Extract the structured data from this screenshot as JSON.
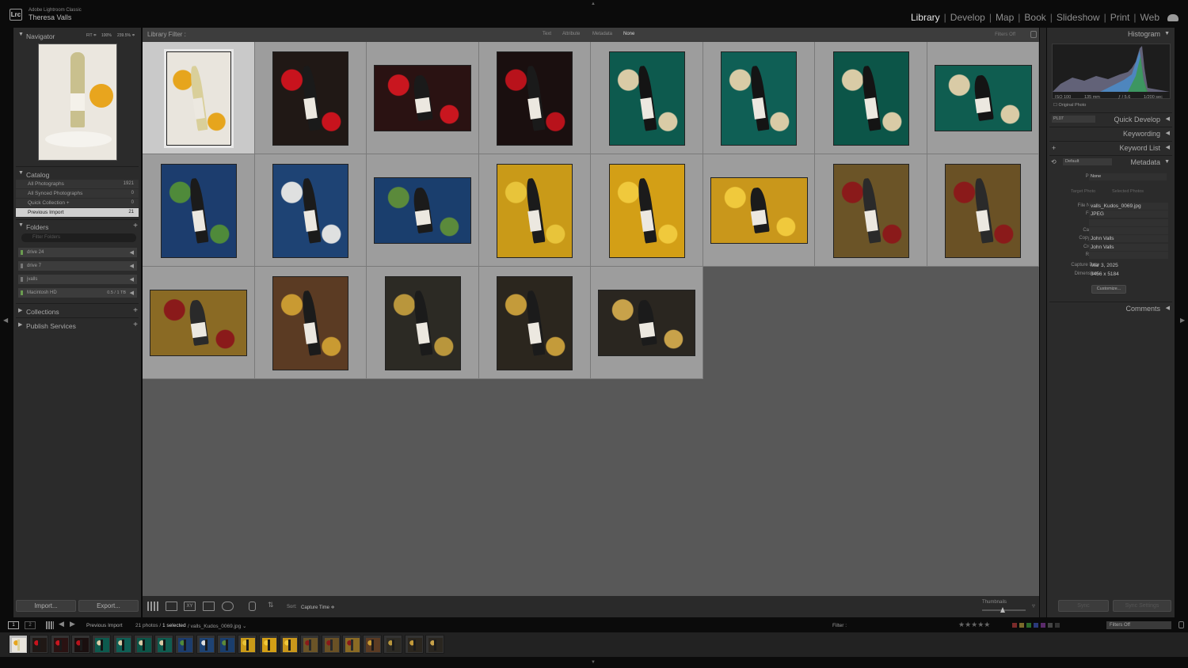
{
  "app": {
    "name": "Adobe Lightroom Classic",
    "logo": "Lrc",
    "user": "Theresa Valls"
  },
  "modules": [
    "Library",
    "Develop",
    "Map",
    "Book",
    "Slideshow",
    "Print",
    "Web"
  ],
  "active_module": "Library",
  "left_panel": {
    "navigator": {
      "title": "Navigator",
      "zoom_fit": "FIT ≑",
      "zoom_100": "100%",
      "zoom_other": "239.5% ≑"
    },
    "catalog": {
      "title": "Catalog",
      "items": [
        {
          "label": "All Photographs",
          "count": "1921"
        },
        {
          "label": "All Synced Photographs",
          "count": "0"
        },
        {
          "label": "Quick Collection +",
          "count": "0"
        },
        {
          "label": "Previous Import",
          "count": "21"
        }
      ]
    },
    "folders": {
      "title": "Folders",
      "search_placeholder": "Filter Folders",
      "drives": [
        {
          "label": "drive 24",
          "info": ""
        },
        {
          "label": "drive 7",
          "info": ""
        },
        {
          "label": "jvalls",
          "info": ""
        },
        {
          "label": "Macintosh HD",
          "info": "0.5 / 1 TB"
        }
      ]
    },
    "collections": {
      "title": "Collections"
    },
    "publish": {
      "title": "Publish Services"
    },
    "import_label": "Import...",
    "export_label": "Export..."
  },
  "library_filter": {
    "label": "Library Filter :",
    "options": [
      "Text",
      "Attribute",
      "Metadata",
      "None"
    ],
    "status": "Filters Off"
  },
  "grid": {
    "thumbnails": [
      {
        "bg": "#e9e5dd",
        "accent": "#e6a51d",
        "bottle": "#d9cf9a",
        "portrait": true
      },
      {
        "bg": "#201815",
        "accent": "#c8131d",
        "bottle": "#1a1a1a",
        "portrait": true
      },
      {
        "bg": "#2a1212",
        "accent": "#c9161f",
        "bottle": "#1a1a1a",
        "portrait": false
      },
      {
        "bg": "#1a0f0f",
        "accent": "#b8121b",
        "bottle": "#1a1a1a",
        "portrait": true
      },
      {
        "bg": "#0d5a4e",
        "accent": "#d9cba6",
        "bottle": "#141414",
        "portrait": true
      },
      {
        "bg": "#0f5f55",
        "accent": "#d9cba6",
        "bottle": "#141414",
        "portrait": true
      },
      {
        "bg": "#0c5548",
        "accent": "#d9cba6",
        "bottle": "#141414",
        "portrait": true
      },
      {
        "bg": "#0f5d50",
        "accent": "#d9cba6",
        "bottle": "#141414",
        "portrait": false
      },
      {
        "bg": "#1c3d6e",
        "accent": "#4f8a3a",
        "bottle": "#1b1b1b",
        "portrait": true
      },
      {
        "bg": "#1e4374",
        "accent": "#dfe0e0",
        "bottle": "#1b1b1b",
        "portrait": true
      },
      {
        "bg": "#1a3e6d",
        "accent": "#5b8a3b",
        "bottle": "#1b1b1b",
        "portrait": false
      },
      {
        "bg": "#c99a18",
        "accent": "#e8c43a",
        "bottle": "#1b1b1b",
        "portrait": true
      },
      {
        "bg": "#d39f16",
        "accent": "#f0c93c",
        "bottle": "#1b1b1b",
        "portrait": true
      },
      {
        "bg": "#c9971b",
        "accent": "#f0c93c",
        "bottle": "#1b1b1b",
        "portrait": false
      },
      {
        "bg": "#6b5427",
        "accent": "#8a1a1a",
        "bottle": "#2a2a2a",
        "portrait": true
      },
      {
        "bg": "#6a5125",
        "accent": "#8a1a1a",
        "bottle": "#2a2a2a",
        "portrait": true
      },
      {
        "bg": "#8a6a24",
        "accent": "#8a1a1a",
        "bottle": "#2a2a2a",
        "portrait": false
      },
      {
        "bg": "#5b3b23",
        "accent": "#c99a32",
        "bottle": "#1b1b1b",
        "portrait": true
      },
      {
        "bg": "#2c2a24",
        "accent": "#b9963c",
        "bottle": "#1b1b1b",
        "portrait": true
      },
      {
        "bg": "#2b261e",
        "accent": "#c49b3a",
        "bottle": "#1b1b1b",
        "portrait": true
      },
      {
        "bg": "#2a2620",
        "accent": "#c8a24a",
        "bottle": "#1b1b1b",
        "portrait": false
      }
    ]
  },
  "toolbar": {
    "sort_label": "Sort:",
    "sort_value": "Capture Time ≑",
    "thumbnails_label": "Thumbnails"
  },
  "right_panel": {
    "histogram": {
      "title": "Histogram",
      "iso": "ISO 100",
      "focal": "135 mm",
      "aperture": "ƒ / 5.6",
      "shutter": "1/200 sec",
      "original_photo": "Original Photo"
    },
    "quick_develop": {
      "title": "Quick Develop",
      "preset": "PL07"
    },
    "keywording": {
      "title": "Keywording"
    },
    "keyword_list": {
      "title": "Keyword List"
    },
    "metadata": {
      "title": "Metadata",
      "set": "Default",
      "preset_label": "Preset",
      "preset_value": "None",
      "target_photo": "Target Photo",
      "selected_photos": "Selected Photos",
      "fields": [
        {
          "key": "File Name",
          "value": "valls_Kudos_0069.jpg"
        },
        {
          "key": "Folder",
          "value": "JPEG"
        },
        {
          "key": "Title",
          "value": ""
        },
        {
          "key": "Caption",
          "value": ""
        },
        {
          "key": "Copyright",
          "value": "John Valls"
        },
        {
          "key": "Creator",
          "value": "John Valls"
        },
        {
          "key": "Rating",
          "value": ""
        }
      ],
      "capture_date_label": "Capture Date",
      "capture_date": "Mar 3, 2025",
      "dimensions_label": "Dimensions",
      "dimensions": "3456 x 5184",
      "customize": "Customize..."
    },
    "comments": {
      "title": "Comments"
    },
    "sync_label": "Sync",
    "sync_settings_label": "Sync Settings"
  },
  "filmstrip_bar": {
    "screen1": "1",
    "screen2": "2",
    "source": "Previous Import",
    "count": "21 photos /",
    "selected": "1 selected",
    "path": "/ valls_Kudos_0069.jpg ⌄",
    "filter_label": "Filter :",
    "filter_value": "Filters Off",
    "stars": "★★★★★"
  }
}
